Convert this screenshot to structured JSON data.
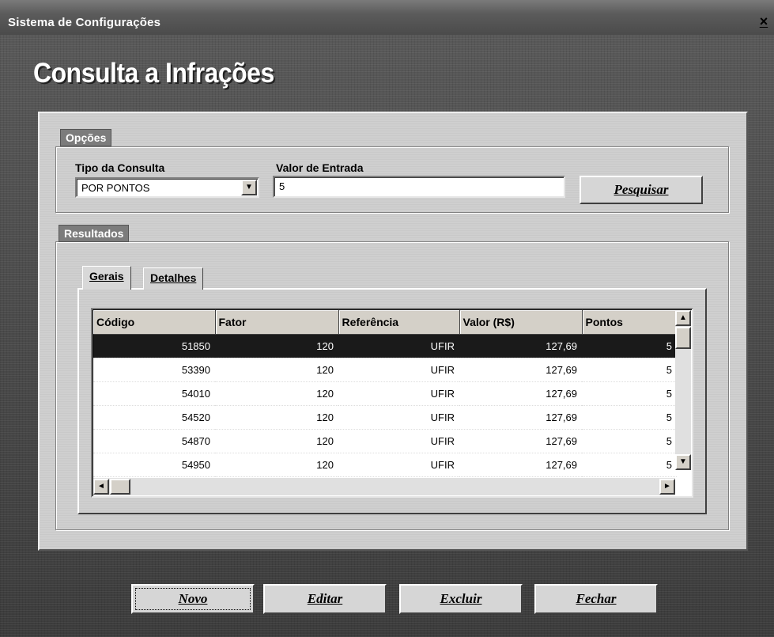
{
  "window": {
    "title": "Sistema de Configurações",
    "close_glyph": "×"
  },
  "heading": "Consulta a Infrações",
  "opcoes": {
    "label": "Opções",
    "tipo_label": "Tipo da Consulta",
    "tipo_value": "POR PONTOS",
    "valor_label": "Valor de Entrada",
    "valor_value": "5",
    "search_button": "Pesquisar"
  },
  "resultados": {
    "label": "Resultados",
    "tabs": [
      {
        "label": "Gerais",
        "active": true
      },
      {
        "label": "Detalhes",
        "active": false
      }
    ],
    "columns": [
      "Código",
      "Fator",
      "Referência",
      "Valor (R$)",
      "Pontos"
    ],
    "rows": [
      {
        "codigo": "51850",
        "fator": "120",
        "referencia": "UFIR",
        "valor": "127,69",
        "pontos": "5",
        "selected": true
      },
      {
        "codigo": "53390",
        "fator": "120",
        "referencia": "UFIR",
        "valor": "127,69",
        "pontos": "5"
      },
      {
        "codigo": "54010",
        "fator": "120",
        "referencia": "UFIR",
        "valor": "127,69",
        "pontos": "5"
      },
      {
        "codigo": "54520",
        "fator": "120",
        "referencia": "UFIR",
        "valor": "127,69",
        "pontos": "5"
      },
      {
        "codigo": "54870",
        "fator": "120",
        "referencia": "UFIR",
        "valor": "127,69",
        "pontos": "5"
      },
      {
        "codigo": "54950",
        "fator": "120",
        "referencia": "UFIR",
        "valor": "127,69",
        "pontos": "5"
      }
    ]
  },
  "buttons": {
    "novo": "Novo",
    "editar": "Editar",
    "excluir": "Excluir",
    "fechar": "Fechar"
  },
  "icons": {
    "dropdown": "chevron-down-icon",
    "scroll_up": "arrow-up-icon",
    "scroll_down": "arrow-down-icon",
    "scroll_left": "arrow-left-icon",
    "scroll_right": "arrow-right-icon"
  }
}
